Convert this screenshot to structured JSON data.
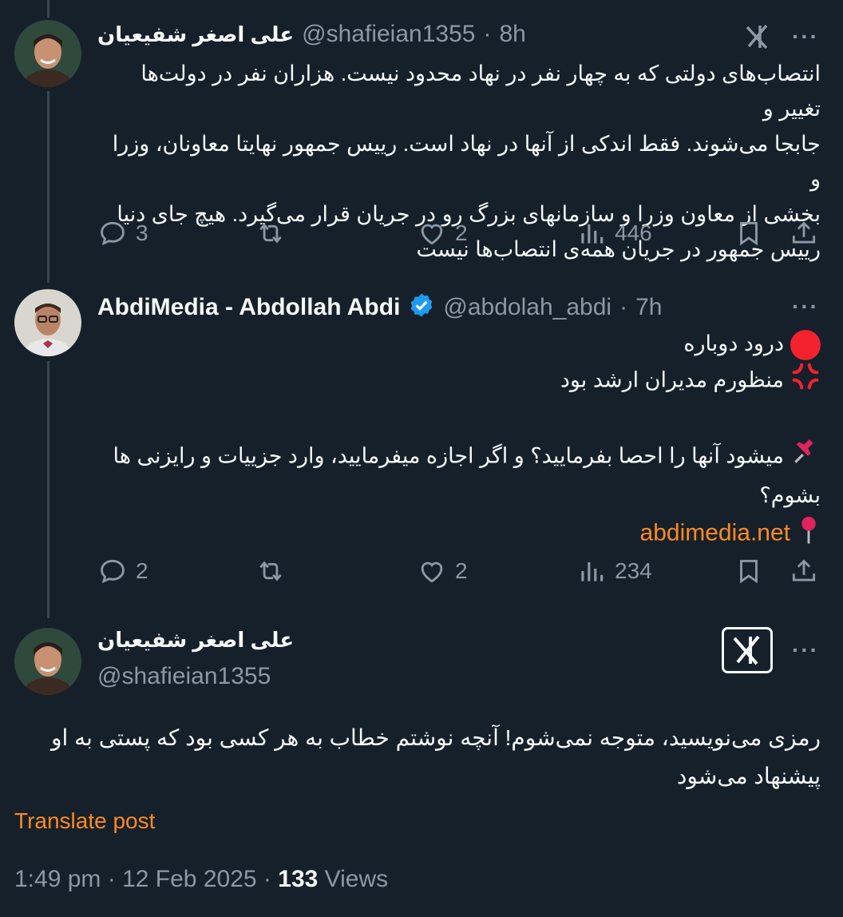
{
  "post1": {
    "name": "علی اصغر شفیعیان",
    "handle": "@shafieian1355",
    "time": "8h",
    "lines": [
      "انتصاب‌های دولتی که به چهار نفر در نهاد محدود نیست. هزاران نفر در دولت‌ها تغییر و",
      "جابجا می‌شوند. فقط اندکی از آنها در نهاد است. رییس جمهور نهایتا معاونان، وزرا و",
      "بخشی از معاون وزرا و سازمانهای بزرگ رو در جریان قرار می‌گیرد. هیچ جای دنیا",
      "رییس جمهور در جریان همه‌ی انتصاب‌ها نیست"
    ],
    "replies": "3",
    "likes": "2",
    "views": "446"
  },
  "post2": {
    "name": "AbdiMedia - Abdollah Abdi",
    "handle": "@abdolah_abdi",
    "time": "7h",
    "lines": [
      "درود دوباره",
      "منظورم مدیران ارشد بود",
      "میشود آنها را احصا بفرمایید؟ و اگر اجازه میفرمایید، وارد جزییات و رایزنی ها",
      "بشوم؟"
    ],
    "link": "abdimedia.net",
    "replies": "2",
    "likes": "2",
    "views": "234"
  },
  "post3": {
    "name": "علی اصغر شفیعیان",
    "handle": "@shafieian1355",
    "lines": [
      "رمزی می‌نویسید، متوجه نمی‌شوم! آنچه نوشتم خطاب به هر کسی بود که پستی به او",
      "پیشنهاد می‌شود"
    ],
    "translate": "Translate post",
    "time": "1:49 pm",
    "date": "12 Feb 2025",
    "views_count": "133",
    "views_label": "Views"
  },
  "ui": {
    "dot": "·",
    "more": "···"
  },
  "colors": {
    "bg": "#15202b",
    "muted": "#8b98a5",
    "accent": "#ff8a1f",
    "verified": "#1d9bf0"
  }
}
